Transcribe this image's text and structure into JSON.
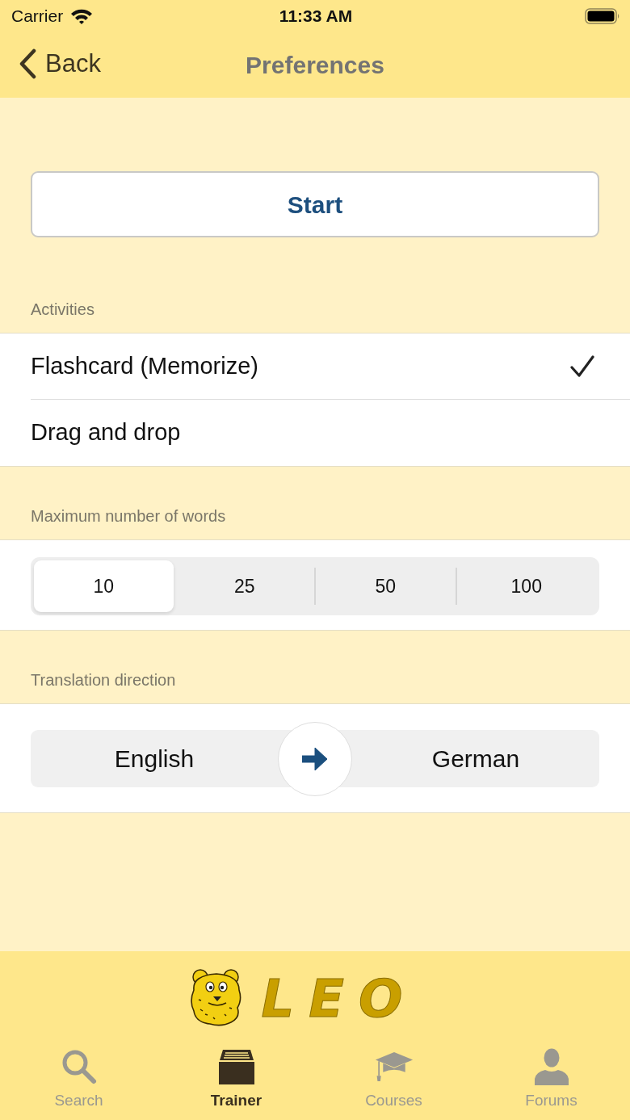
{
  "status_bar": {
    "carrier": "Carrier",
    "time": "11:33 AM"
  },
  "nav": {
    "back": "Back",
    "title": "Preferences"
  },
  "start_button": "Start",
  "sections": [
    {
      "header": "Activities",
      "kind": "checklist",
      "items": [
        {
          "label": "Flashcard (Memorize)",
          "checked": true
        },
        {
          "label": "Drag and drop",
          "checked": false
        }
      ]
    },
    {
      "header": "Maximum number of words",
      "kind": "segmented",
      "segments": [
        {
          "label": "10",
          "selected": true
        },
        {
          "label": "25",
          "selected": false
        },
        {
          "label": "50",
          "selected": false
        },
        {
          "label": "100",
          "selected": false
        }
      ]
    },
    {
      "header": "Translation direction",
      "kind": "direction",
      "from": "English",
      "to": "German"
    }
  ],
  "logo": {
    "text": "LEO"
  },
  "tabs": [
    {
      "label": "Search",
      "selected": false
    },
    {
      "label": "Trainer",
      "selected": true
    },
    {
      "label": "Courses",
      "selected": false
    },
    {
      "label": "Forums",
      "selected": false
    }
  ]
}
